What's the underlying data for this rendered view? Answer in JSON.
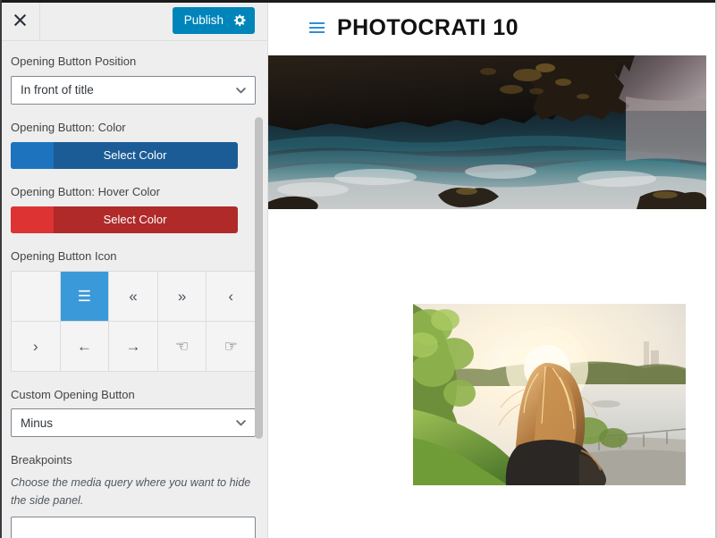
{
  "window": {
    "accent_blue": "#0085ba",
    "sidebar_bg": "#eeeeee"
  },
  "sidebar": {
    "header": {
      "close_icon": "close-icon",
      "publish_label": "Publish",
      "gear_icon": "gear-icon"
    },
    "fields": {
      "opening_button_position": {
        "label": "Opening Button Position",
        "value": "In front of title"
      },
      "opening_button_color": {
        "label": "Opening Button: Color",
        "button_text": "Select Color",
        "swatch_color": "#1e73be",
        "body_color": "#1b5c96"
      },
      "opening_button_hover_color": {
        "label": "Opening Button: Hover Color",
        "button_text": "Select Color",
        "swatch_color": "#dd3333",
        "body_color": "#b02a2a"
      },
      "opening_button_icon": {
        "label": "Opening Button Icon",
        "selected_index": 1,
        "icons": [
          {
            "name": "none-icon",
            "glyph": ""
          },
          {
            "name": "hamburger-menu-icon",
            "glyph": "☰"
          },
          {
            "name": "chevron-double-left-icon",
            "glyph": "«"
          },
          {
            "name": "chevron-double-right-icon",
            "glyph": "»"
          },
          {
            "name": "chevron-left-icon",
            "glyph": "‹"
          },
          {
            "name": "chevron-right-icon",
            "glyph": "›"
          },
          {
            "name": "arrow-left-icon",
            "glyph": "←"
          },
          {
            "name": "arrow-right-icon",
            "glyph": "→"
          },
          {
            "name": "hand-point-left-icon",
            "glyph": "☜"
          },
          {
            "name": "hand-point-right-icon",
            "glyph": "☞"
          }
        ]
      },
      "custom_opening_button": {
        "label": "Custom Opening Button",
        "value": "Minus"
      },
      "breakpoints": {
        "label": "Breakpoints",
        "description": "Choose the media query where you want to hide the side panel.",
        "value": ""
      }
    }
  },
  "preview": {
    "menu_icon": "hamburger-menu-icon",
    "site_title": "PHOTOCRATI 10",
    "hero_image": {
      "name": "coastal-cliff-ocean-photo",
      "alt": "Dark coastal cliff with teal ocean waves"
    },
    "photo_two": {
      "name": "woman-sunset-river-photo",
      "alt": "Backlit woman with long hair overlooking a river at sunset"
    }
  }
}
